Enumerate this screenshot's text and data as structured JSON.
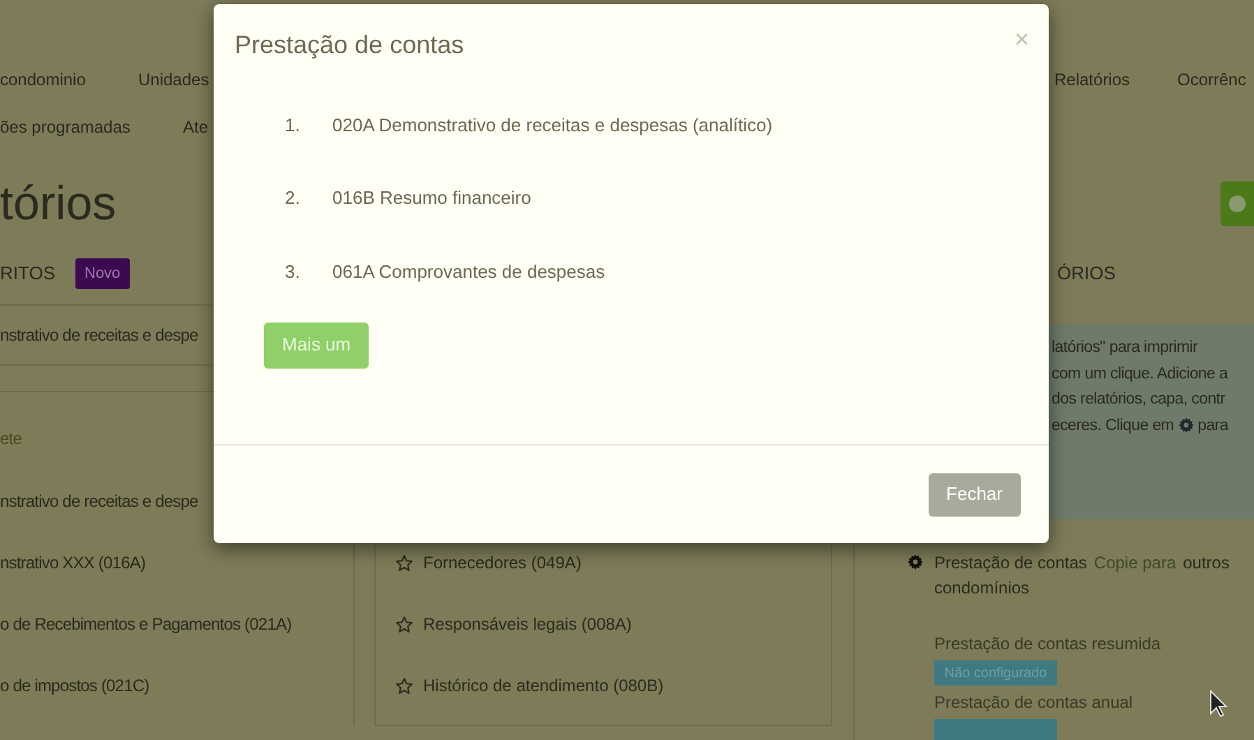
{
  "nav": {
    "row_1": [
      "condominio",
      "Unidades",
      "Relatórios",
      "Ocorrênc"
    ],
    "row_2": [
      "ões programadas",
      "Ate"
    ]
  },
  "page_title": "tórios",
  "favorites": {
    "heading": "RITOS",
    "badge": "Novo",
    "item": "nstrativo de receitas e despe"
  },
  "right_heading": "ÓRIOS",
  "left_panel": {
    "subtitle": "ete",
    "items": [
      "nstrativo de receitas e despe",
      "nstrativo XXX (016A)",
      "o de Recebimentos e Pagamentos (021A)",
      "o de impostos (021C)"
    ]
  },
  "middle_panel": {
    "items": [
      "Fornecedores (049A)",
      "Responsáveis legais (008A)",
      "Histórico de atendimento (080B)"
    ]
  },
  "right_panel": {
    "info_lines": [
      "latórios\" para imprimir",
      "com um clique. Adicione a",
      "dos relatórios, capa, contr"
    ],
    "info_last_before": "eceres. Clique em",
    "info_last_after": "para",
    "package": {
      "title": "Prestação de contas",
      "copy_link": "Copie para",
      "copy_rest": "outros condomínios"
    },
    "reports": [
      {
        "name": "Prestação de contas resumida",
        "status": "Não configurado"
      },
      {
        "name": "Prestação de contas anual"
      }
    ]
  },
  "modal": {
    "title": "Prestação de contas",
    "close": "×",
    "items": [
      {
        "number": "1.",
        "text": "020A Demonstrativo de receitas e despesas (analítico)"
      },
      {
        "number": "2.",
        "text": "016B Resumo financeiro"
      },
      {
        "number": "3.",
        "text": "061A Comprovantes de despesas"
      }
    ],
    "add_button": "Mais um",
    "close_button": "Fechar"
  }
}
